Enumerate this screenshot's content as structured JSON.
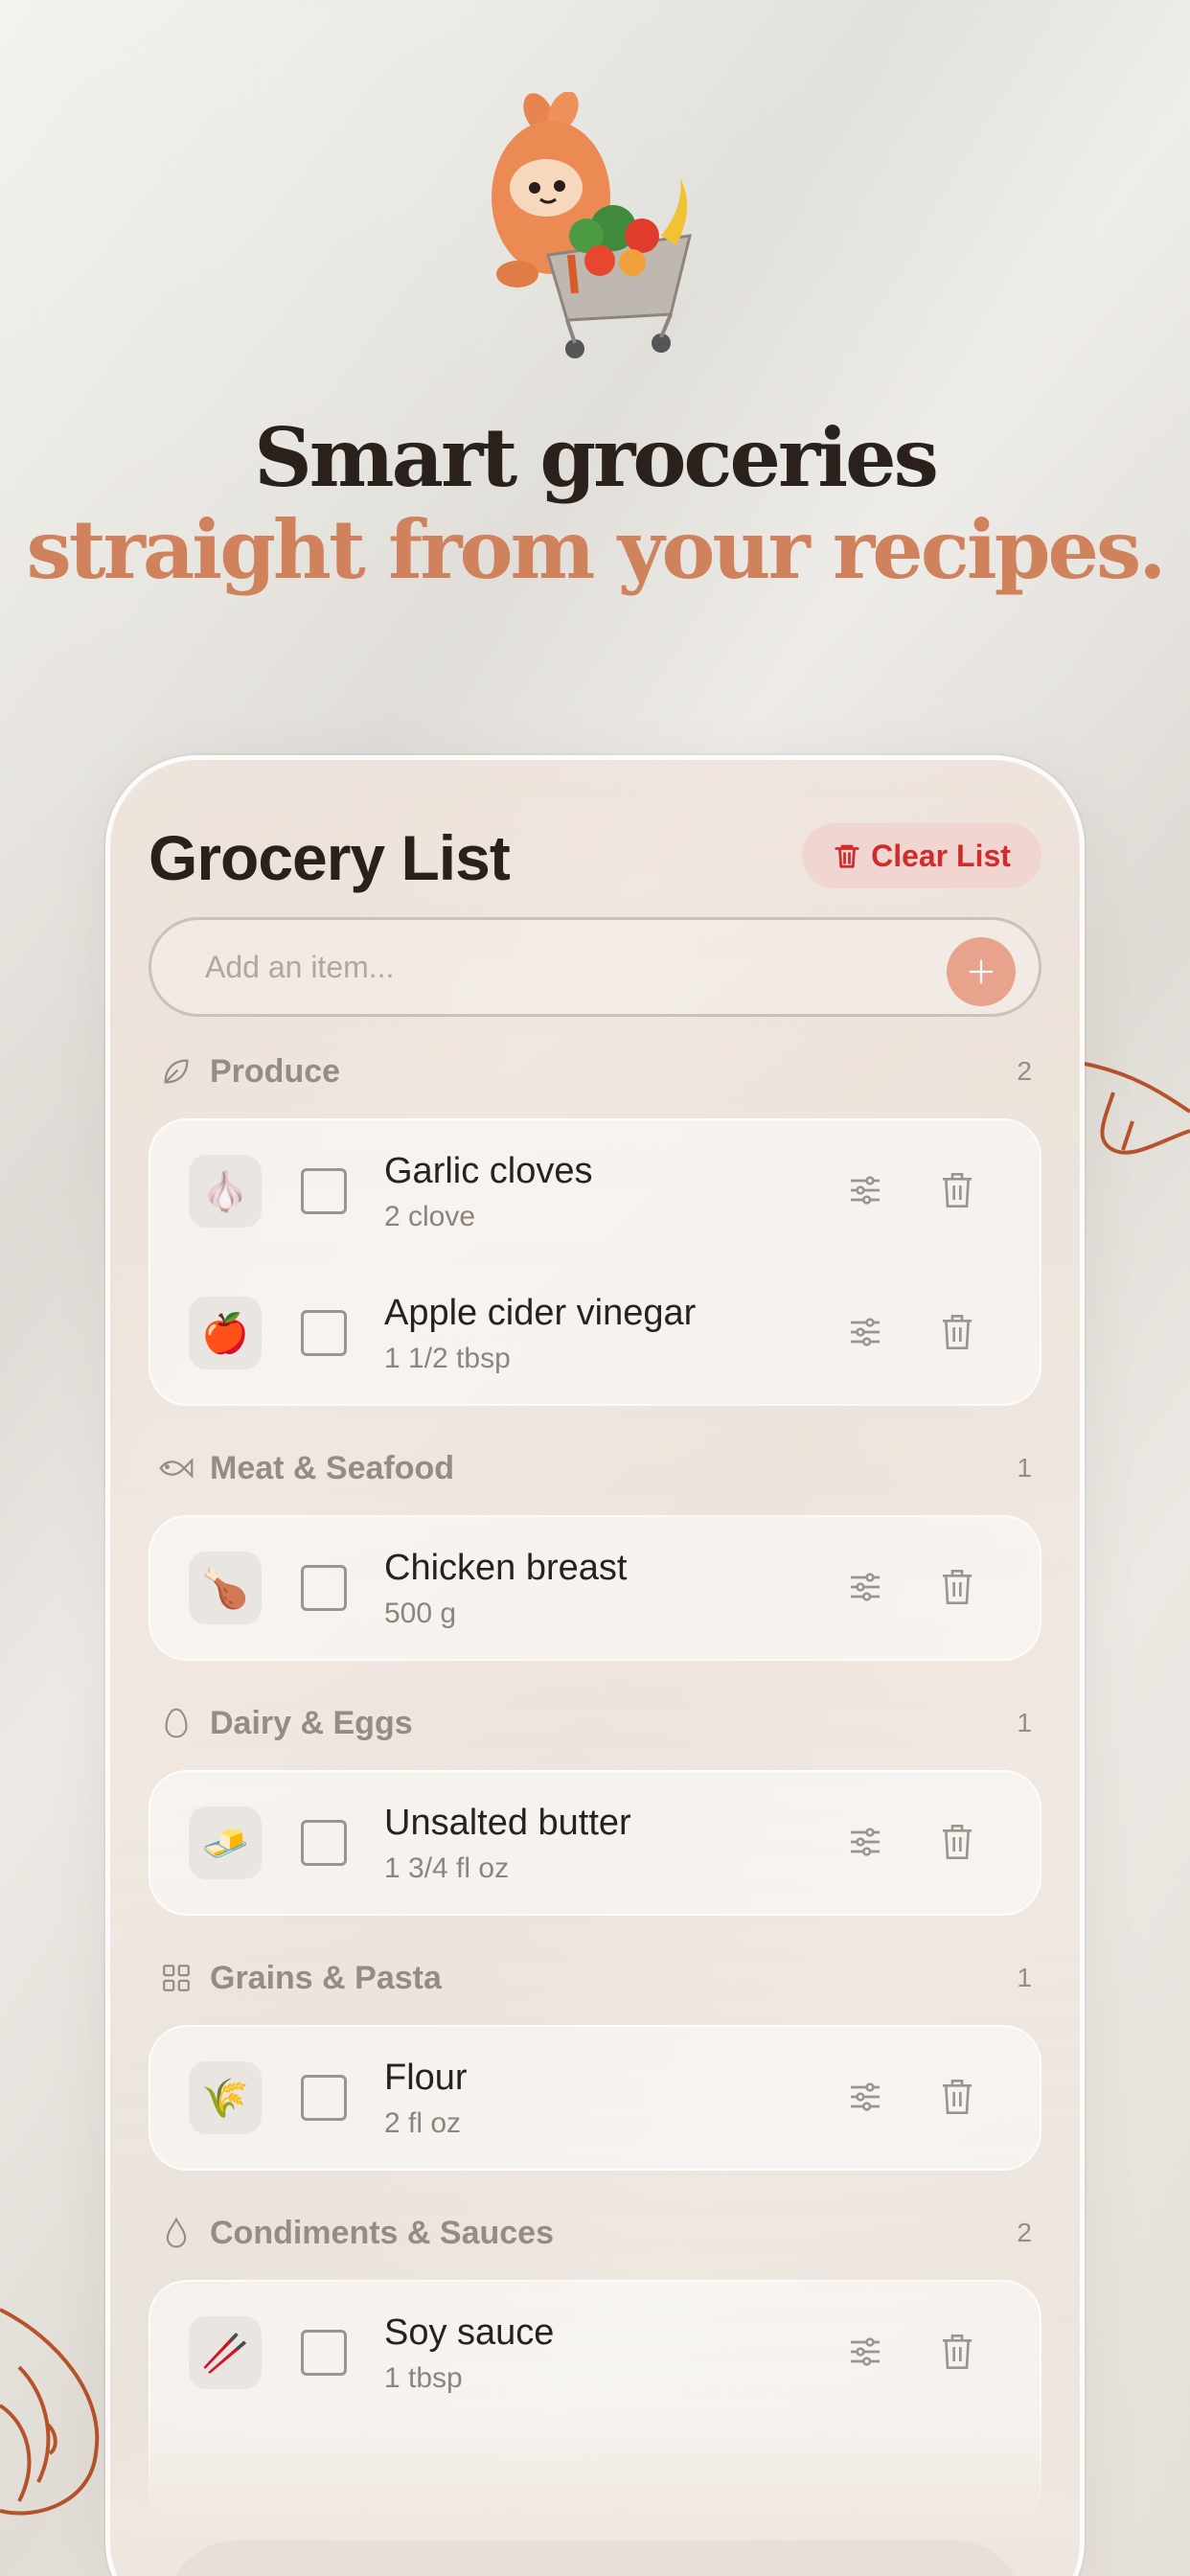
{
  "headline": {
    "line1": "Smart groceries",
    "line2": "straight from your recipes."
  },
  "app": {
    "title": "Grocery List",
    "clear_button": "Clear List",
    "add_placeholder": "Add an item..."
  },
  "colors": {
    "accent": "#cf825c",
    "danger": "#d22b2b",
    "add_button": "#e8a38d"
  },
  "sections": [
    {
      "name": "Produce",
      "count": "2",
      "icon": "leaf-icon",
      "items": [
        {
          "emoji": "🧄",
          "name": "Garlic cloves",
          "qty": "2 clove"
        },
        {
          "emoji": "🍎",
          "name": "Apple cider vinegar",
          "qty": "1 1/2 tbsp"
        }
      ]
    },
    {
      "name": "Meat & Seafood",
      "count": "1",
      "icon": "fish-icon",
      "items": [
        {
          "emoji": "🍗",
          "name": "Chicken breast",
          "qty": "500 g"
        }
      ]
    },
    {
      "name": "Dairy & Eggs",
      "count": "1",
      "icon": "egg-icon",
      "items": [
        {
          "emoji": "🧈",
          "name": "Unsalted butter",
          "qty": "1 3/4 fl oz"
        }
      ]
    },
    {
      "name": "Grains & Pasta",
      "count": "1",
      "icon": "grid-icon",
      "items": [
        {
          "emoji": "🌾",
          "name": "Flour",
          "qty": "2 fl oz"
        }
      ]
    },
    {
      "name": "Condiments & Sauces",
      "count": "2",
      "icon": "droplet-icon",
      "items": [
        {
          "emoji": "🥢",
          "name": "Soy sauce",
          "qty": "1 tbsp"
        }
      ]
    }
  ]
}
